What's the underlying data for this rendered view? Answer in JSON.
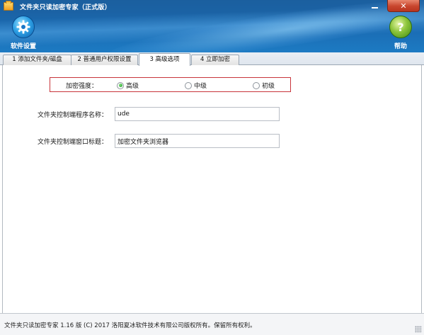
{
  "window": {
    "title": "文件夹只读加密专家（正式版）",
    "minimize_icon": "minimize-icon",
    "close_icon": "close-icon",
    "close_glyph": "✕"
  },
  "toolbar": {
    "settings_label": "软件设置",
    "settings_icon": "gear-icon",
    "help_label": "帮助",
    "help_icon": "help-icon",
    "help_glyph": "?"
  },
  "tabs": [
    {
      "label": "1 添加文件夹/磁盘",
      "active": false
    },
    {
      "label": "2 普通用户权限设置",
      "active": false
    },
    {
      "label": "3 高级选项",
      "active": true
    },
    {
      "label": "4 立即加密",
      "active": false
    }
  ],
  "advanced": {
    "strength_label": "加密强度：",
    "strength_options": [
      {
        "label": "高级",
        "selected": true
      },
      {
        "label": "中级",
        "selected": false
      },
      {
        "label": "初级",
        "selected": false
      }
    ],
    "program_name_label": "文件夹控制端程序名称：",
    "program_name_value": "ude",
    "window_title_label": "文件夹控制端窗口标题：",
    "window_title_value": "加密文件夹浏览器"
  },
  "status": {
    "text": "文件夹只读加密专家 1.16 版 (C) 2017 洛阳夏冰软件技术有限公司版权所有。保留所有权利。"
  },
  "colors": {
    "header_blue": "#1b62a4",
    "strength_box_border": "#c8343a",
    "close_red": "#c8452d"
  }
}
